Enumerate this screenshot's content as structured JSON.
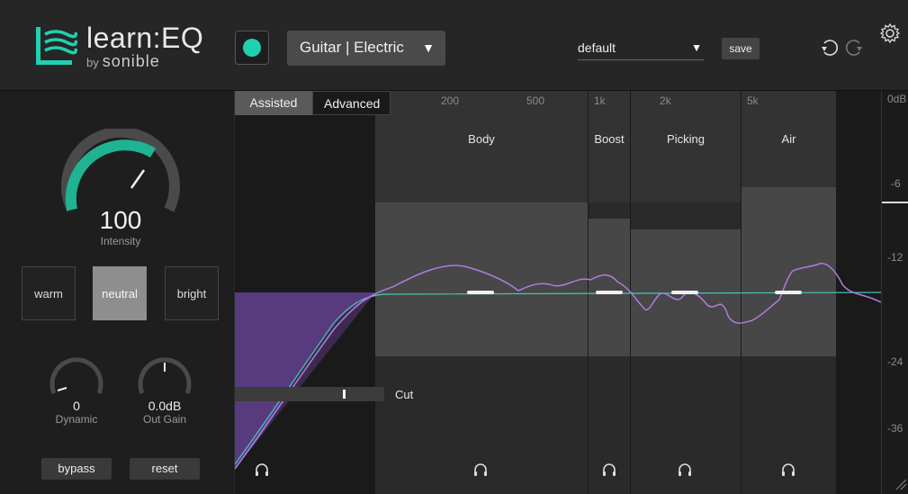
{
  "header": {
    "logo_title": "learn:EQ",
    "logo_by": "by",
    "logo_brand": "sonible",
    "profile": "Guitar | Electric",
    "preset": "default",
    "save_label": "save"
  },
  "left_panel": {
    "intensity_value": "100",
    "intensity_label": "Intensity",
    "timbre_buttons": [
      "warm",
      "neutral",
      "bright"
    ],
    "active_timbre": "neutral",
    "dynamic_value": "0",
    "dynamic_label": "Dynamic",
    "outgain_value": "0.0dB",
    "outgain_label": "Out Gain",
    "bypass_label": "bypass",
    "reset_label": "reset"
  },
  "eq": {
    "modes": [
      "Assisted",
      "Advanced"
    ],
    "active_mode": "Assisted",
    "freq_labels": [
      "200",
      "500",
      "1k",
      "2k",
      "5k"
    ],
    "bands": [
      "Body",
      "Boost",
      "Picking",
      "Air"
    ],
    "cut_label": "Cut"
  },
  "meter": {
    "db_labels": [
      "0dB",
      "-6",
      "-12",
      "-24",
      "-36"
    ]
  },
  "colors": {
    "accent": "#1fd1b0",
    "curve": "#b07be0",
    "target_line": "#45c8b8"
  }
}
